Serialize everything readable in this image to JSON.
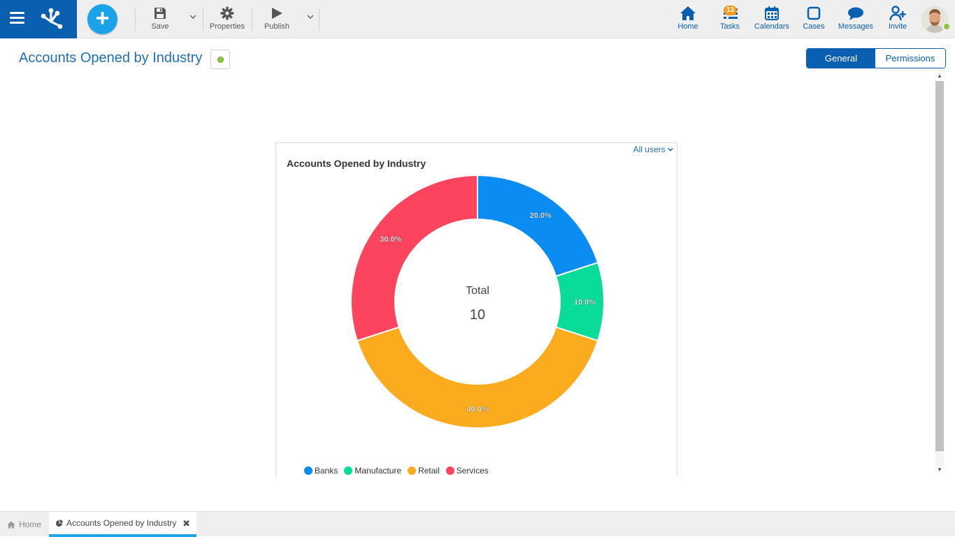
{
  "toolbar": {
    "save_label": "Save",
    "properties_label": "Properties",
    "publish_label": "Publish"
  },
  "nav": {
    "home_label": "Home",
    "tasks_label": "Tasks",
    "tasks_badge": "13",
    "calendars_label": "Calendars",
    "cases_label": "Cases",
    "messages_label": "Messages",
    "invite_label": "Invite"
  },
  "page": {
    "title": "Accounts Opened by Industry",
    "tabs": [
      {
        "label": "General",
        "active": true
      },
      {
        "label": "Permissions",
        "active": false
      }
    ]
  },
  "chart_card": {
    "user_filter": "All users",
    "center_label": "Total",
    "center_value": "10"
  },
  "chart_data": {
    "type": "pie",
    "title": "Accounts Opened by Industry",
    "donut": true,
    "categories": [
      "Banks",
      "Manufacture",
      "Retail",
      "Services"
    ],
    "values": [
      2,
      1,
      4,
      3
    ],
    "percent_labels": [
      "20.0%",
      "10.0%",
      "40.0%",
      "30.0%"
    ],
    "colors": [
      "#0a8cf2",
      "#08dc98",
      "#fbac1e",
      "#fd445e"
    ],
    "legend_position": "bottom-left"
  },
  "bottom_tabs": {
    "home_label": "Home",
    "current_label": "Accounts Opened by Industry"
  },
  "colors": {
    "brand": "#0b5fb0",
    "accent": "#1aa3e8",
    "status_ok": "#8cc63f",
    "badge": "#f39a1e"
  },
  "icons": {
    "menu": "hamburger-icon",
    "add": "plus-icon",
    "save": "floppy-icon",
    "properties": "gear-icon",
    "publish": "play-icon",
    "home": "house-icon",
    "tasks": "task-list-icon",
    "calendars": "calendar-icon",
    "cases": "square-icon",
    "messages": "chat-bubble-icon",
    "invite": "add-user-icon"
  }
}
